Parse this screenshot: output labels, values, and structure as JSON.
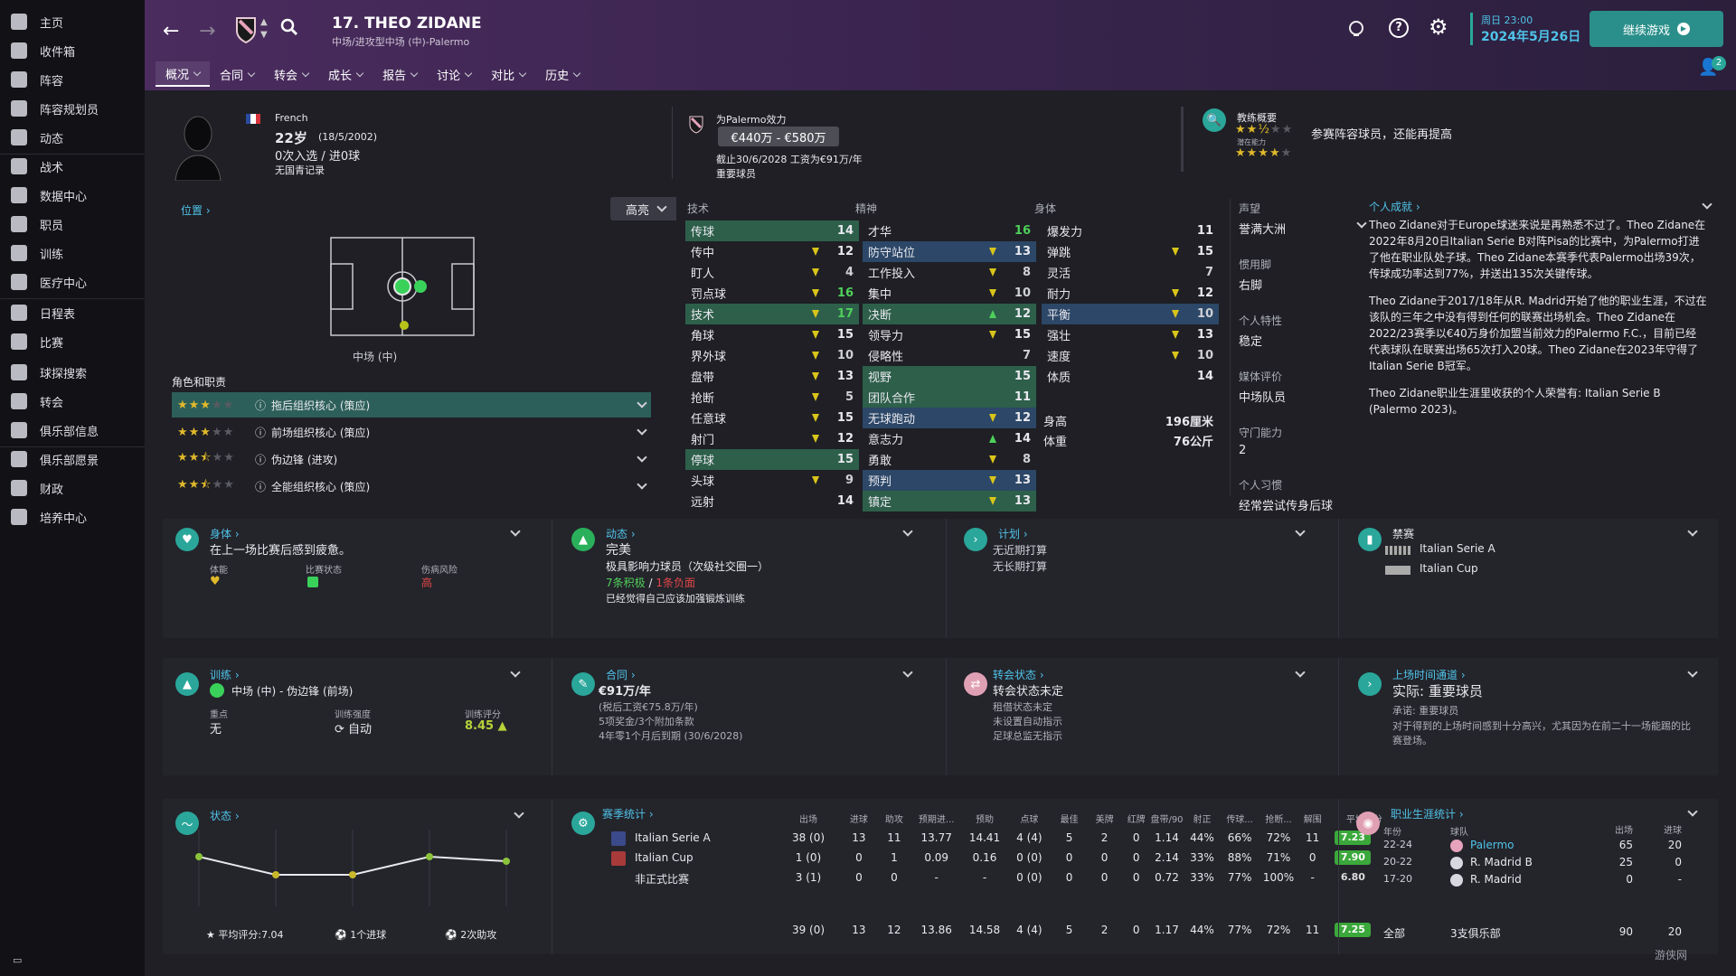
{
  "sidebar": {
    "items": [
      "主页",
      "收件箱",
      "阵容",
      "阵容规划员",
      "动态",
      "战术",
      "数据中心",
      "职员",
      "训练",
      "医疗中心",
      "日程表",
      "比赛",
      "球探搜索",
      "转会",
      "俱乐部信息",
      "俱乐部愿景",
      "财政",
      "培养中心"
    ]
  },
  "header": {
    "player_title": "17. THEO ZIDANE",
    "subtitle": "中场/进攻型中场 (中)-Palermo",
    "tabs": [
      "概况",
      "合同",
      "转会",
      "成长",
      "报告",
      "讨论",
      "对比",
      "历史"
    ],
    "date_day": "周日 23:00",
    "date": "2024年5月26日",
    "continue_label": "继续游戏",
    "notify_count": "2"
  },
  "profile": {
    "nationality": "French",
    "age": "22岁",
    "dob": "(18/5/2002)",
    "caps": "0次入选 / 进0球",
    "youth": "无国青记录",
    "club_label": "为Palermo效力",
    "value": "€440万 - €580万",
    "contract": "截止30/6/2028 工资为€91万/年",
    "status": "重要球员",
    "coach_title": "教练概要",
    "coach_text": "参赛阵容球员，还能再提高",
    "potential_label": "潜在能力"
  },
  "position": {
    "title": "位置",
    "highlight": "高亮",
    "pos_label": "中场 (中)",
    "roles_title": "角色和职责",
    "roles": [
      {
        "name": "拖后组织核心 (策应)",
        "stars": 3
      },
      {
        "name": "前场组织核心 (策应)",
        "stars": 3
      },
      {
        "name": "伪边锋 (进攻)",
        "stars": 2.5
      },
      {
        "name": "全能组织核心 (策应)",
        "stars": 2.5
      }
    ]
  },
  "attributes": {
    "tech_title": "技术",
    "mental_title": "精神",
    "phys_title": "身体",
    "technical": [
      [
        "传球",
        "14",
        "",
        "hl"
      ],
      [
        "传中",
        "12",
        "y",
        ""
      ],
      [
        "盯人",
        "4",
        "y",
        ""
      ],
      [
        "罚点球",
        "16",
        "y",
        ""
      ],
      [
        "技术",
        "17",
        "y",
        "hl"
      ],
      [
        "角球",
        "15",
        "y",
        ""
      ],
      [
        "界外球",
        "10",
        "y",
        ""
      ],
      [
        "盘带",
        "13",
        "y",
        ""
      ],
      [
        "抢断",
        "5",
        "y",
        ""
      ],
      [
        "任意球",
        "15",
        "y",
        ""
      ],
      [
        "射门",
        "12",
        "y",
        ""
      ],
      [
        "停球",
        "15",
        "",
        "hl"
      ],
      [
        "头球",
        "9",
        "y",
        ""
      ],
      [
        "远射",
        "14",
        "",
        ""
      ]
    ],
    "mental": [
      [
        "才华",
        "16",
        "",
        ""
      ],
      [
        "防守站位",
        "13",
        "y",
        "hl2"
      ],
      [
        "工作投入",
        "8",
        "y",
        ""
      ],
      [
        "集中",
        "10",
        "y",
        ""
      ],
      [
        "决断",
        "12",
        "g",
        "hl"
      ],
      [
        "领导力",
        "15",
        "y",
        ""
      ],
      [
        "侵略性",
        "7",
        "",
        ""
      ],
      [
        "视野",
        "15",
        "",
        "hl"
      ],
      [
        "团队合作",
        "11",
        "",
        "hl"
      ],
      [
        "无球跑动",
        "12",
        "y",
        "hl2"
      ],
      [
        "意志力",
        "14",
        "g",
        ""
      ],
      [
        "勇敢",
        "8",
        "y",
        ""
      ],
      [
        "预判",
        "13",
        "y",
        "hl2"
      ],
      [
        "镇定",
        "13",
        "y",
        "hl"
      ]
    ],
    "physical": [
      [
        "爆发力",
        "11",
        "",
        ""
      ],
      [
        "弹跳",
        "15",
        "y",
        ""
      ],
      [
        "灵活",
        "7",
        "",
        ""
      ],
      [
        "耐力",
        "12",
        "y",
        ""
      ],
      [
        "平衡",
        "10",
        "y",
        "hl2"
      ],
      [
        "强壮",
        "13",
        "y",
        ""
      ],
      [
        "速度",
        "10",
        "y",
        ""
      ],
      [
        "体质",
        "14",
        "",
        ""
      ]
    ],
    "height_label": "身高",
    "height": "196厘米",
    "weight_label": "体重",
    "weight": "76公斤"
  },
  "info": {
    "rep_label": "声望",
    "rep": "誉满大洲",
    "foot_label": "惯用脚",
    "foot": "右脚",
    "trait_label": "个人特性",
    "trait": "稳定",
    "media_label": "媒体评价",
    "media": "中场队员",
    "gk_label": "守门能力",
    "gk": "2",
    "habit_label": "个人习惯",
    "habit": "经常尝试传身后球"
  },
  "bio": {
    "title": "个人成就",
    "p1": "Theo Zidane对于Europe球迷来说是再熟悉不过了。Theo Zidane在2022年8月20日Italian Serie B对阵Pisa的比赛中，为Palermo打进了他在职业队处子球。Theo Zidane本赛季代表Palermo出场39次，传球成功率达到77%，并送出135次关键传球。",
    "p2": "Theo Zidane于2017/18年从R. Madrid开始了他的职业生涯，不过在该队的三年之中没有得到任何的联赛出场机会。Theo Zidane在2022/23赛季以€40万身价加盟当前效力的Palermo F.C.，目前已经代表球队在联赛出场65次打入20球。Theo Zidane在2023年守得了Italian Serie B冠军。",
    "p3": "Theo Zidane职业生涯里收获的个人荣誉有: Italian Serie B (Palermo 2023)。"
  },
  "cards": {
    "body": {
      "title": "身体",
      "text": "在上一场比赛后感到疲惫。",
      "l1": "体能",
      "l2": "比赛状态",
      "l3": "伤病风险",
      "v3": "高"
    },
    "dyn": {
      "title": "动态",
      "v": "完美",
      "t1": "极具影响力球员（次级社交圈一）",
      "pos": "7条积极",
      "sep": "/",
      "neg": "1条负面",
      "t2": "已经觉得自己应该加强锻炼训练"
    },
    "plan": {
      "title": "计划",
      "l1": "无近期打算",
      "l2": "无长期打算"
    },
    "ban": {
      "title": "禁赛",
      "c1": "Italian Serie A",
      "c2": "Italian Cup"
    },
    "train": {
      "title": "训练",
      "role": "中场 (中) - 伪边锋 (前场)",
      "focus_label": "重点",
      "focus": "无",
      "int_label": "训练强度",
      "int": "自动",
      "score_label": "训练评分",
      "score": "8.45"
    },
    "contract": {
      "title": "合同",
      "wage": "€91万/年",
      "net": "(税后工资€75.8万/年)",
      "bonus": "5项奖金/3个附加条款",
      "exp": "4年零1个月后到期 (30/6/2028)"
    },
    "transfer": {
      "title": "转会状态",
      "v": "转会状态未定",
      "l1": "租借状态未定",
      "l2": "未设置自动指示",
      "l3": "足球总监无指示"
    },
    "playtime": {
      "title": "上场时间通道",
      "v": "实际: 重要球员",
      "l1": "承诺: 重要球员",
      "l2": "对于得到的上场时间感到十分高兴，尤其因为在前二十一场能踢的比赛登场。"
    }
  },
  "form": {
    "title": "状态",
    "avg": "平均评分:7.04",
    "goals": "1个进球",
    "assists": "2次助攻"
  },
  "season": {
    "title": "赛季统计",
    "headers": [
      "出场",
      "进球",
      "助攻",
      "预期进...",
      "预助",
      "点球",
      "最佳",
      "美牌",
      "红牌",
      "盘带/90",
      "射正",
      "传球...",
      "抢断...",
      "解围",
      "平均评分"
    ],
    "rows": [
      {
        "name": "Italian Serie A",
        "vals": [
          "38 (0)",
          "13",
          "11",
          "13.77",
          "14.41",
          "4 (4)",
          "5",
          "2",
          "0",
          "1.14",
          "44%",
          "66%",
          "72%",
          "11"
        ],
        "rating": "7.23"
      },
      {
        "name": "Italian Cup",
        "vals": [
          "1 (0)",
          "0",
          "1",
          "0.09",
          "0.16",
          "0 (0)",
          "0",
          "0",
          "0",
          "2.14",
          "33%",
          "88%",
          "71%",
          "0"
        ],
        "rating": "7.90"
      },
      {
        "name": "非正式比赛",
        "vals": [
          "3 (1)",
          "0",
          "0",
          "-",
          "-",
          "0 (0)",
          "0",
          "0",
          "0",
          "0.72",
          "33%",
          "77%",
          "100%",
          "-"
        ],
        "rating": "6.80"
      }
    ],
    "total": {
      "vals": [
        "39 (0)",
        "13",
        "12",
        "13.86",
        "14.58",
        "4 (4)",
        "5",
        "2",
        "0",
        "1.17",
        "44%",
        "77%",
        "72%",
        "11"
      ],
      "rating": "7.25"
    }
  },
  "career": {
    "title": "职业生涯统计",
    "h_year": "年份",
    "h_team": "球队",
    "h_apps": "出场",
    "h_goals": "进球",
    "rows": [
      [
        "22-24",
        "Palermo",
        "65",
        "20"
      ],
      [
        "20-22",
        "R. Madrid B",
        "25",
        "0"
      ],
      [
        "17-20",
        "R. Madrid",
        "0",
        "-"
      ]
    ],
    "tot_label": "全部",
    "tot_team": "3支俱乐部",
    "tot_apps": "90",
    "tot_goals": "20"
  },
  "form_chart": {
    "values": [
      7.1,
      6.9,
      6.9,
      7.1,
      7.05
    ]
  },
  "colors": {
    "accent": "#2aa69a",
    "positive": "#4fd05a",
    "negative": "#e04848",
    "link": "#4fc3e8",
    "highlight": "#2d5f4a"
  },
  "watermark": "游侠网"
}
